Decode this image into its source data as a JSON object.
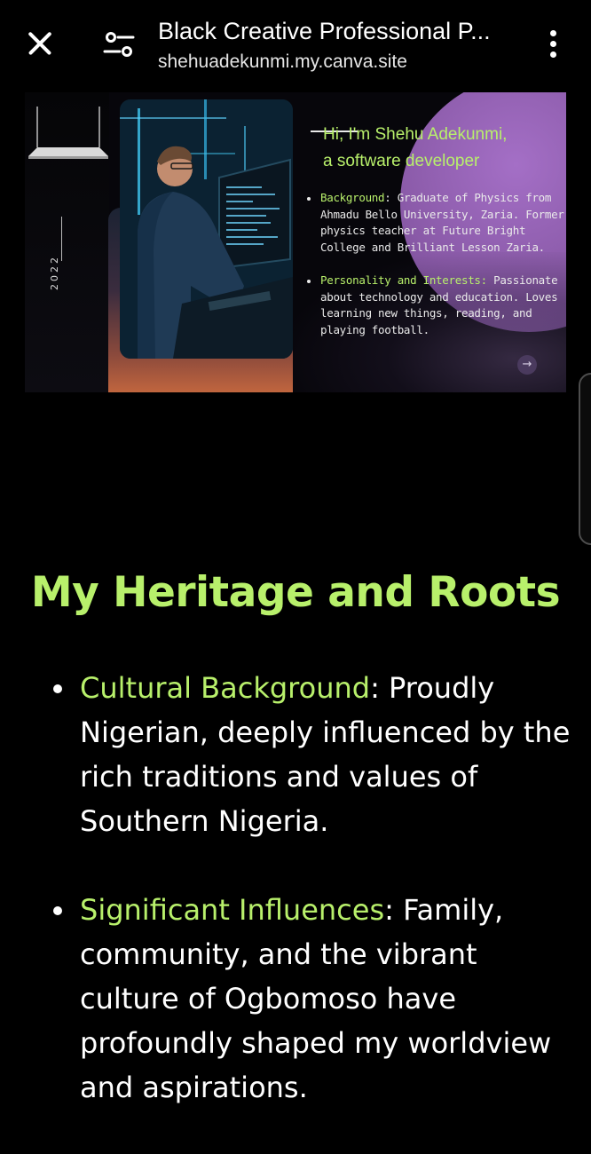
{
  "browser": {
    "title": "Black Creative Professional P...",
    "url": "shehuadekunmi.my.canva.site"
  },
  "slide": {
    "year": "2022",
    "intro": "Hi, I'm Shehu Adekunmi,",
    "intro_line2": "a software developer",
    "items": [
      {
        "label": "Background",
        "text": ": Graduate of Physics from Ahmadu Bello University, Zaria. Former physics teacher at Future Bright College and Brilliant Lesson Zaria."
      },
      {
        "label": "Personality and Interests:",
        "text": " Passionate about technology and education. Loves learning new things, reading, and playing football."
      }
    ]
  },
  "section": {
    "heading": "My Heritage and Roots",
    "items": [
      {
        "label": "Cultural Background",
        "text": ": Proudly Nigerian, deeply influenced by the rich traditions and values of Southern Nigeria."
      },
      {
        "label": "Significant Influences",
        "text": ": Family, community, and the vibrant culture of Ogbomoso have profoundly shaped my worldview and aspirations."
      }
    ]
  },
  "colors": {
    "accent": "#b8f06b",
    "background": "#000000",
    "orb": "#a46fc6"
  },
  "icons": {
    "close": "close-icon",
    "tune": "tune-icon",
    "menu": "more-vert-icon",
    "next": "arrow-right-icon"
  }
}
